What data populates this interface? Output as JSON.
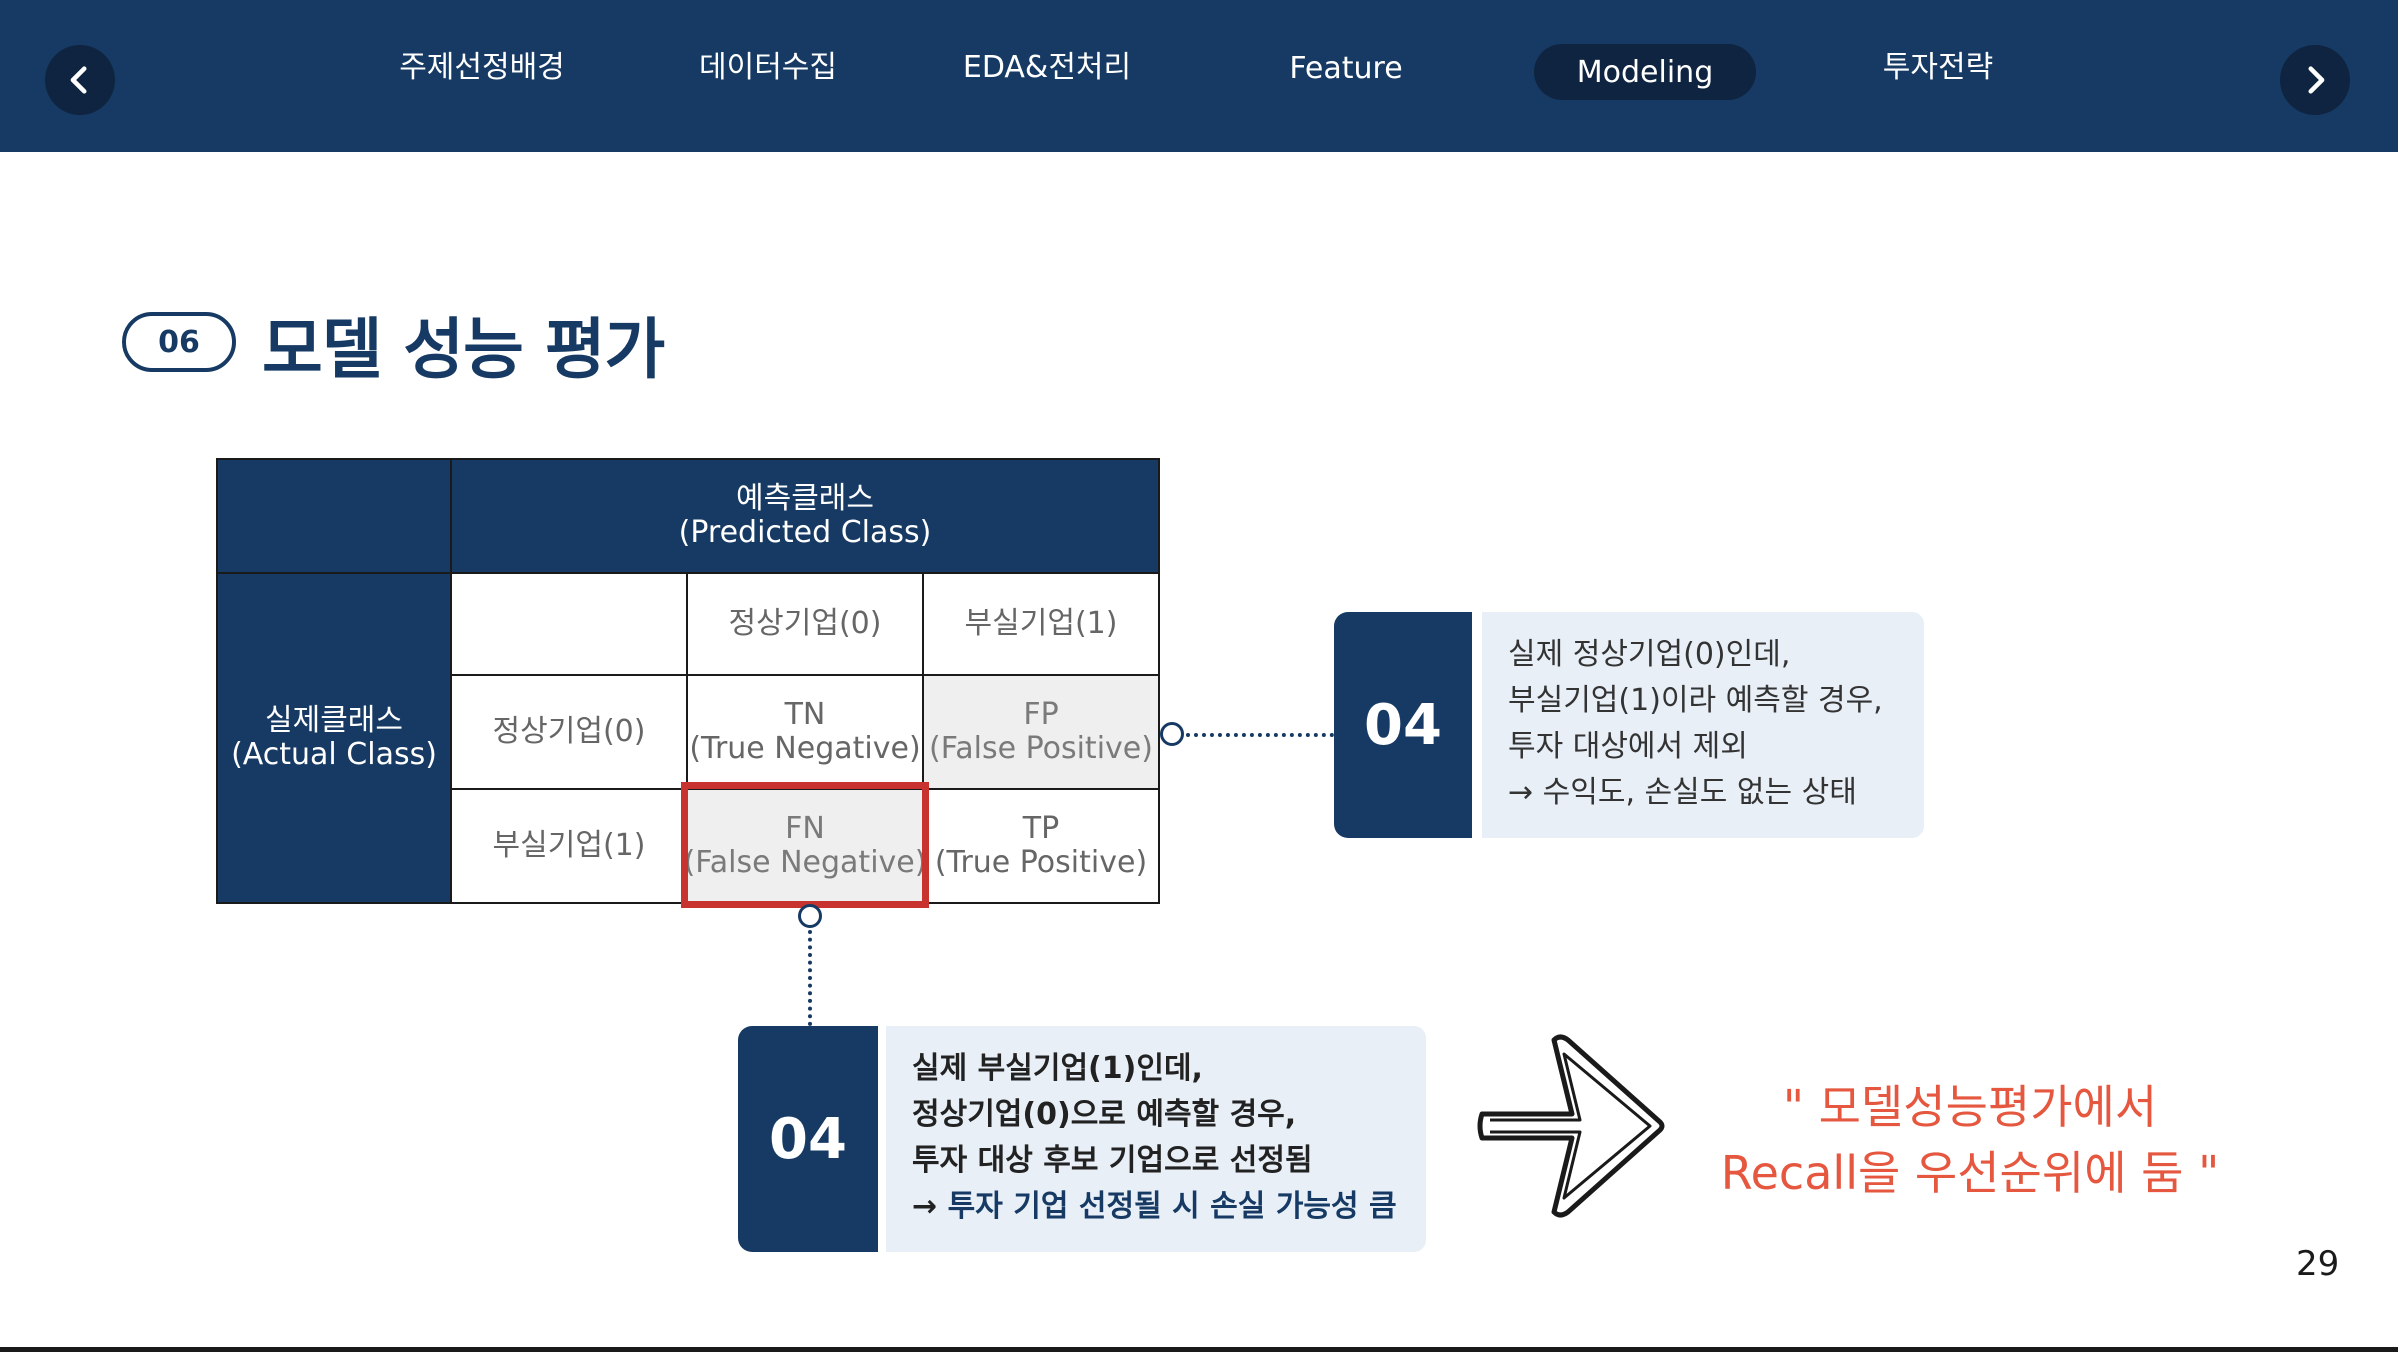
{
  "nav": {
    "tabs": [
      {
        "label": "주제선정배경"
      },
      {
        "label": "데이터수집"
      },
      {
        "label": "EDA&전처리"
      },
      {
        "label": "Feature"
      },
      {
        "label": "Modeling",
        "active": true
      },
      {
        "label": "투자전략"
      }
    ],
    "prev_icon": "chevron-left-icon",
    "next_icon": "chevron-right-icon"
  },
  "section": {
    "number": "06",
    "title": "모델 성능 평가"
  },
  "matrix": {
    "predicted_header": [
      "예측클래스",
      "(Predicted Class)"
    ],
    "actual_header": [
      "실제클래스",
      "(Actual Class)"
    ],
    "columns": [
      "정상기업(0)",
      "부실기업(1)"
    ],
    "rows": [
      {
        "label": "정상기업(0)",
        "cells": [
          [
            "TN",
            "(True Negative)"
          ],
          [
            "FP",
            "(False Positive)"
          ]
        ]
      },
      {
        "label": "부실기업(1)",
        "cells": [
          [
            "FN",
            "(False Negative)"
          ],
          [
            "TP",
            "(True Positive)"
          ]
        ]
      }
    ]
  },
  "callout_fp": {
    "number": "04",
    "lines": [
      "실제 정상기업(0)인데,",
      "부실기업(1)이라 예측할 경우,",
      "투자 대상에서 제외",
      "→ 수익도, 손실도 없는 상태"
    ]
  },
  "callout_fn": {
    "number": "04",
    "lines": [
      "실제 부실기업(1)인데,",
      "정상기업(0)으로 예측할 경우,",
      "투자 대상 후보 기업으로 선정됨"
    ],
    "arrow": "→",
    "highlight": "투자 기업 선정될 시 손실 가능성 큼"
  },
  "conclusion": {
    "lines": [
      "\" 모델성능평가에서",
      "Recall을 우선순위에 둠 \""
    ]
  },
  "page_number": "29",
  "colors": {
    "navy": "#163a63",
    "dark_navy": "#0f2440",
    "highlight_red": "#c8322f",
    "conclusion_orange": "#e5573f",
    "callout_bg": "#e8eff7"
  }
}
